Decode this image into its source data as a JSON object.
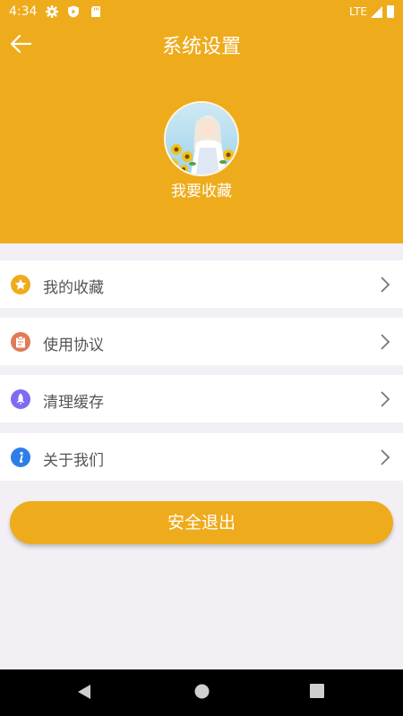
{
  "status": {
    "time": "4:34",
    "network": "LTE"
  },
  "header": {
    "title": "系统设置"
  },
  "profile": {
    "name": "我要收藏"
  },
  "menu": [
    {
      "label": "我的收藏",
      "icon": "star-icon",
      "color": "#eeab1c"
    },
    {
      "label": "使用协议",
      "icon": "document-icon",
      "color": "#e27a57"
    },
    {
      "label": "清理缓存",
      "icon": "rocket-icon",
      "color": "#7d6cf2"
    },
    {
      "label": "关于我们",
      "icon": "info-icon",
      "color": "#2f7ee8"
    }
  ],
  "logout": {
    "label": "安全退出"
  },
  "colors": {
    "primary": "#eeab1c",
    "background": "#f2f0f4"
  }
}
